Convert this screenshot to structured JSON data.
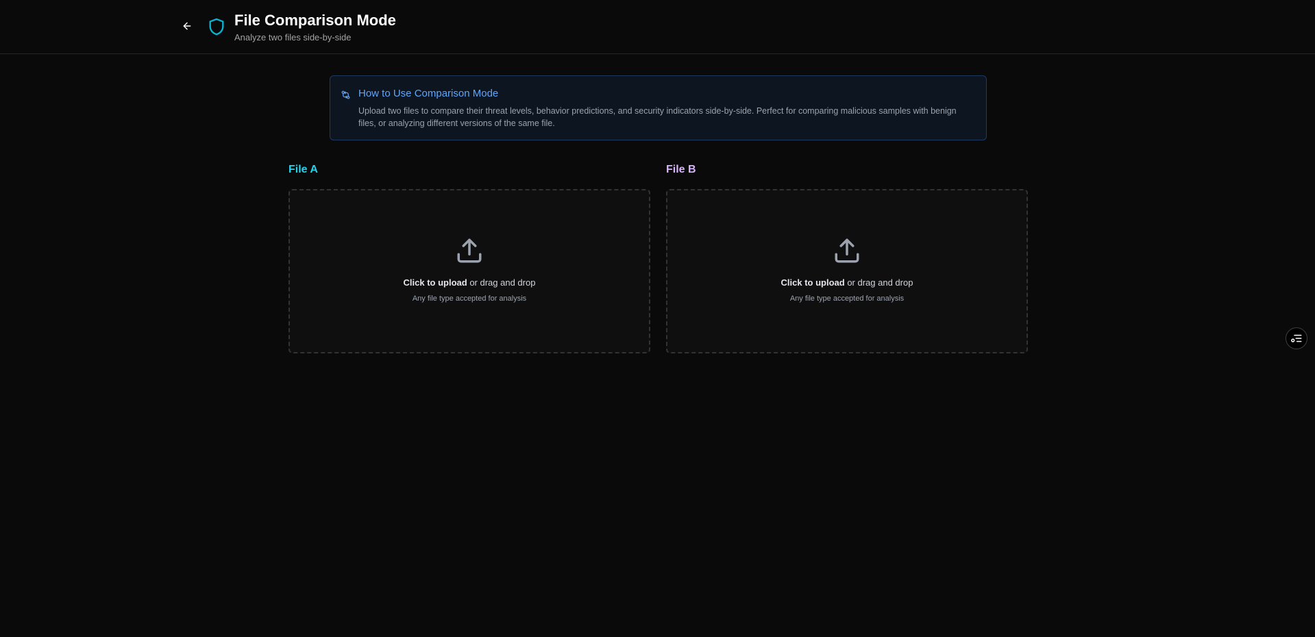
{
  "header": {
    "title": "File Comparison Mode",
    "subtitle": "Analyze two files side-by-side",
    "back_icon": "arrow-left-icon",
    "logo_icon": "shield-icon"
  },
  "info": {
    "icon": "git-compare-icon",
    "title": "How to Use Comparison Mode",
    "text": "Upload two files to compare their threat levels, behavior predictions, and security indicators side-by-side. Perfect for comparing malicious samples with benign files, or analyzing different versions of the same file."
  },
  "file_a": {
    "label": "File A",
    "upload_strong": "Click to upload",
    "upload_rest": " or drag and drop",
    "hint": "Any file type accepted for analysis"
  },
  "file_b": {
    "label": "File B",
    "upload_strong": "Click to upload",
    "upload_rest": " or drag and drop",
    "hint": "Any file type accepted for analysis"
  },
  "floating_button": {
    "icon": "list-settings-icon"
  },
  "colors": {
    "background": "#0a0a0a",
    "accent_shield": "#06b6d4",
    "info_title": "#60a5fa",
    "file_a": "#22d3ee",
    "file_b": "#d8b4fe"
  }
}
